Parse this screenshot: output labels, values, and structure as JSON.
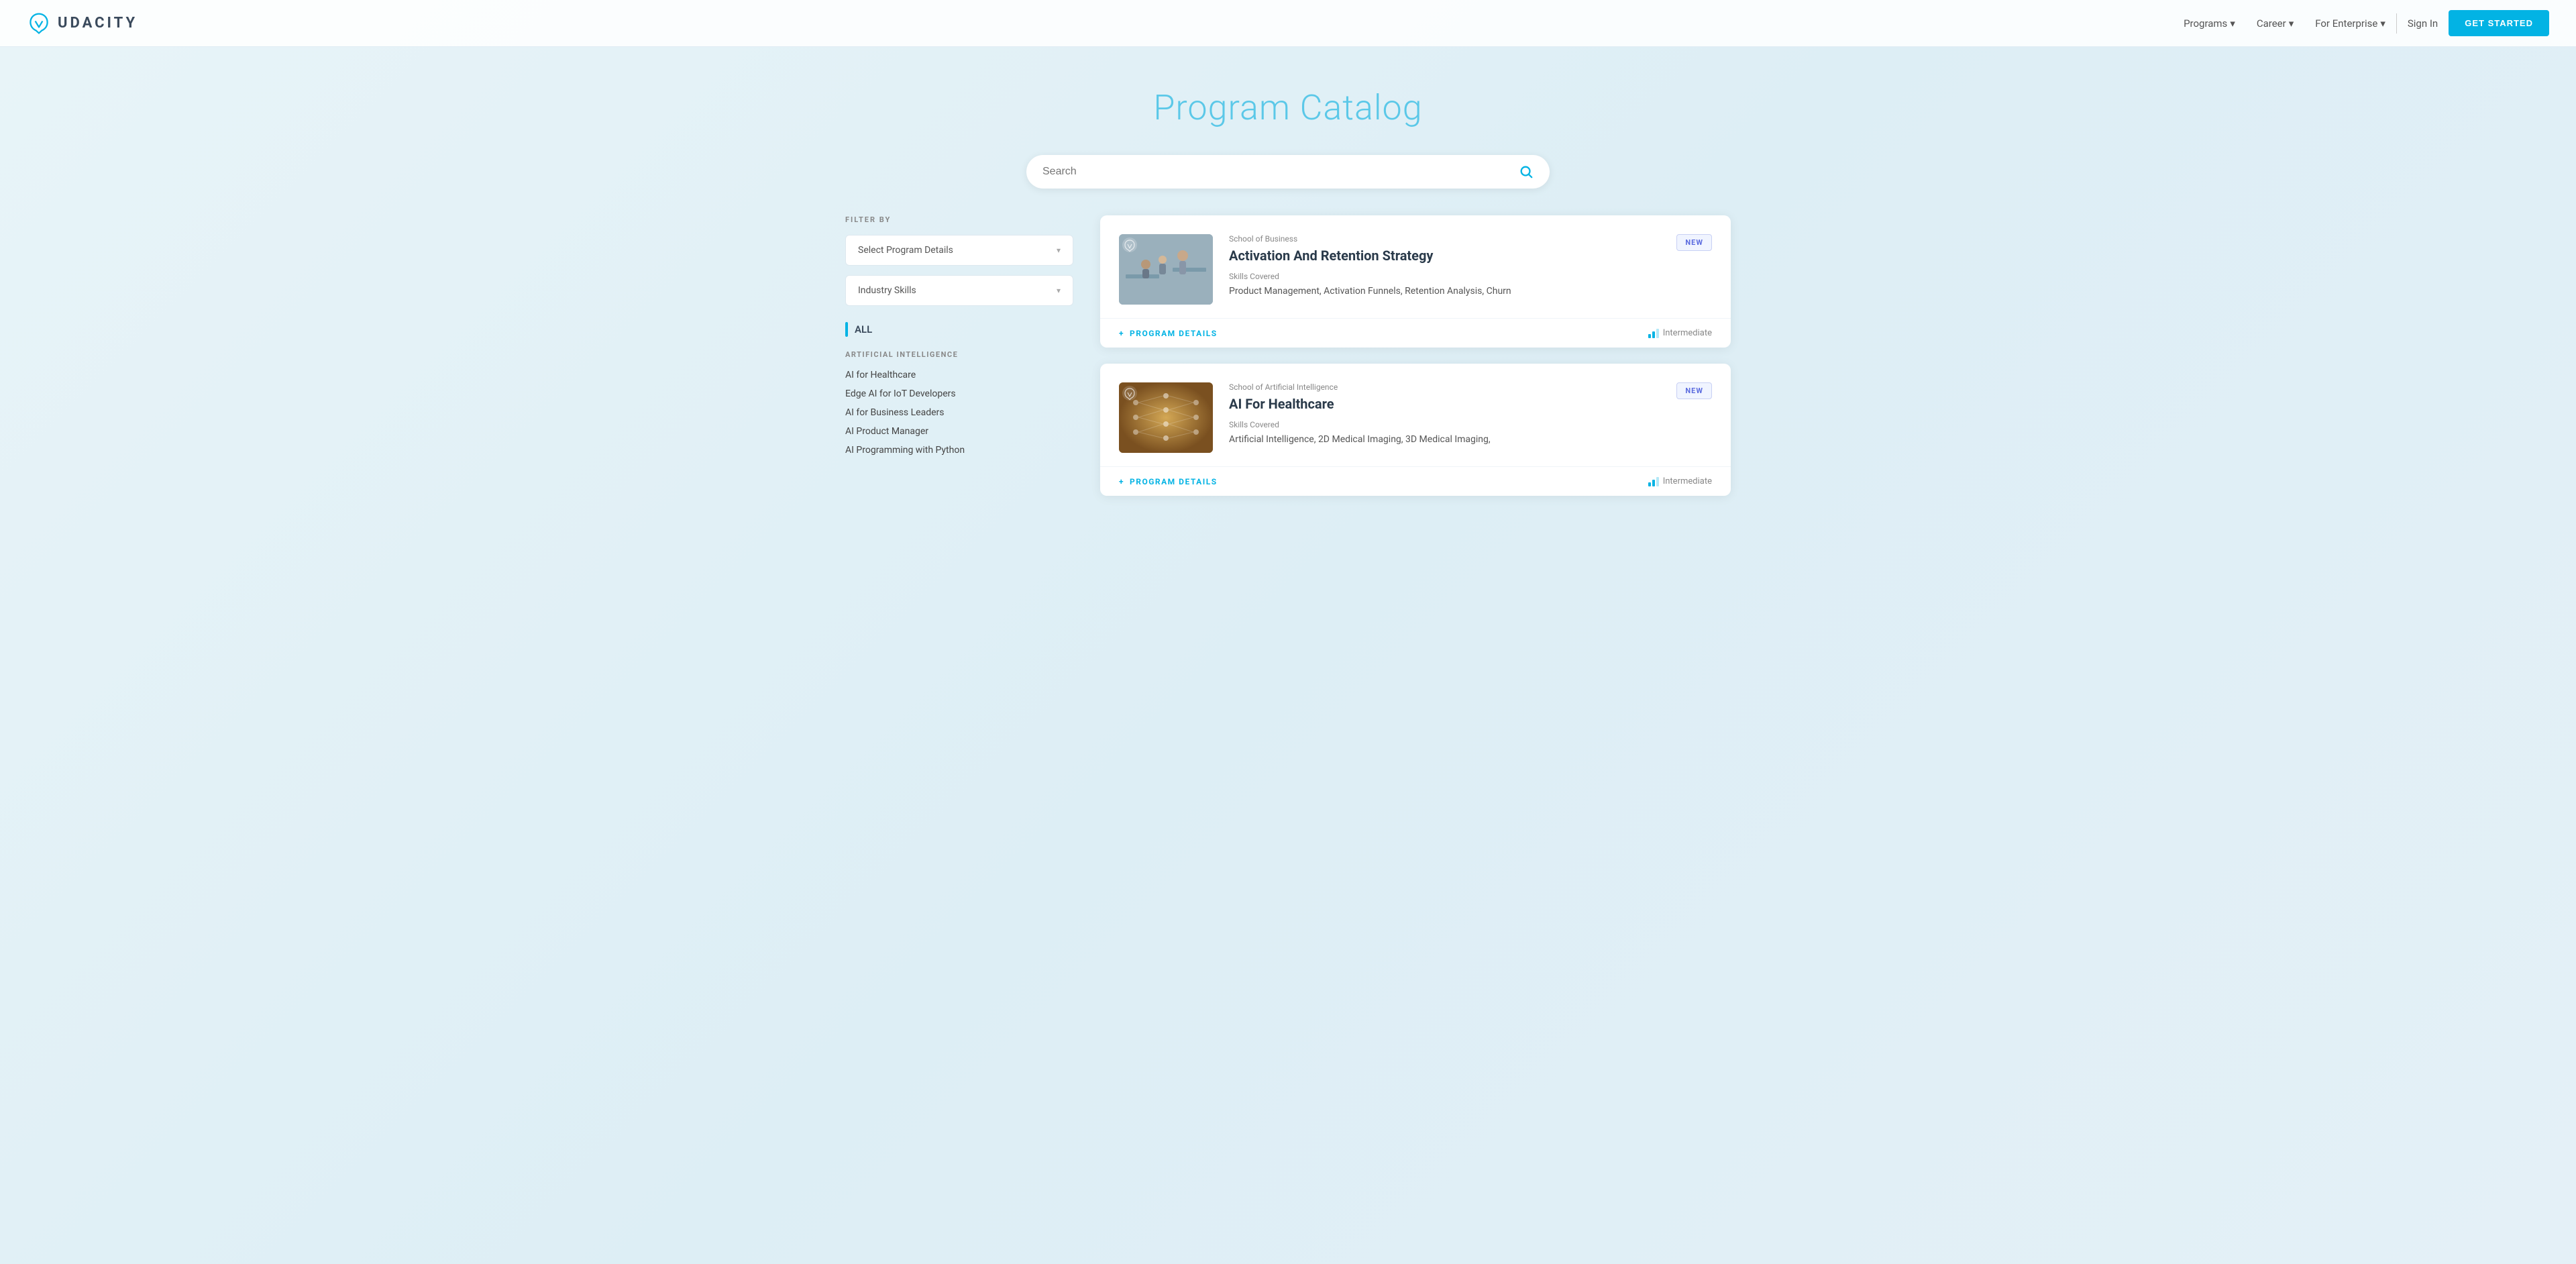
{
  "nav": {
    "logo_text": "UDACITY",
    "links": [
      {
        "label": "Programs",
        "has_dropdown": true
      },
      {
        "label": "Career",
        "has_dropdown": true
      },
      {
        "label": "For Enterprise",
        "has_dropdown": true
      }
    ],
    "signin_label": "Sign In",
    "get_started_label": "GET STARTED"
  },
  "hero": {
    "title": "Program Catalog"
  },
  "search": {
    "placeholder": "Search"
  },
  "sidebar": {
    "filter_by_label": "FILTER BY",
    "dropdown1": {
      "label": "Select Program Details",
      "placeholder": "Select Program Details"
    },
    "dropdown2": {
      "label": "Industry Skills",
      "placeholder": "Industry Skills"
    },
    "all_label": "ALL",
    "categories": [
      {
        "title": "ARTIFICIAL INTELLIGENCE",
        "items": [
          "AI for Healthcare",
          "Edge AI for IoT Developers",
          "AI for Business Leaders",
          "AI Product Manager",
          "AI Programming with Python"
        ]
      }
    ]
  },
  "cards": [
    {
      "id": "card-1",
      "school": "School of Business",
      "title": "Activation And Retention Strategy",
      "skills_label": "Skills Covered",
      "skills": "Product Management, Activation Funnels, Retention Analysis, Churn",
      "badge": "NEW",
      "program_details_label": "PROGRAM DETAILS",
      "level": "Intermediate",
      "thumbnail_type": "business"
    },
    {
      "id": "card-2",
      "school": "School of Artificial Intelligence",
      "title": "AI For Healthcare",
      "skills_label": "Skills Covered",
      "skills": "Artificial Intelligence, 2D Medical Imaging, 3D Medical Imaging,",
      "badge": "NEW",
      "program_details_label": "PROGRAM DETAILS",
      "level": "Intermediate",
      "thumbnail_type": "ai"
    }
  ],
  "icons": {
    "search": "🔍",
    "chevron_down": "▾",
    "plus": "+",
    "bar_chart": "📊"
  }
}
